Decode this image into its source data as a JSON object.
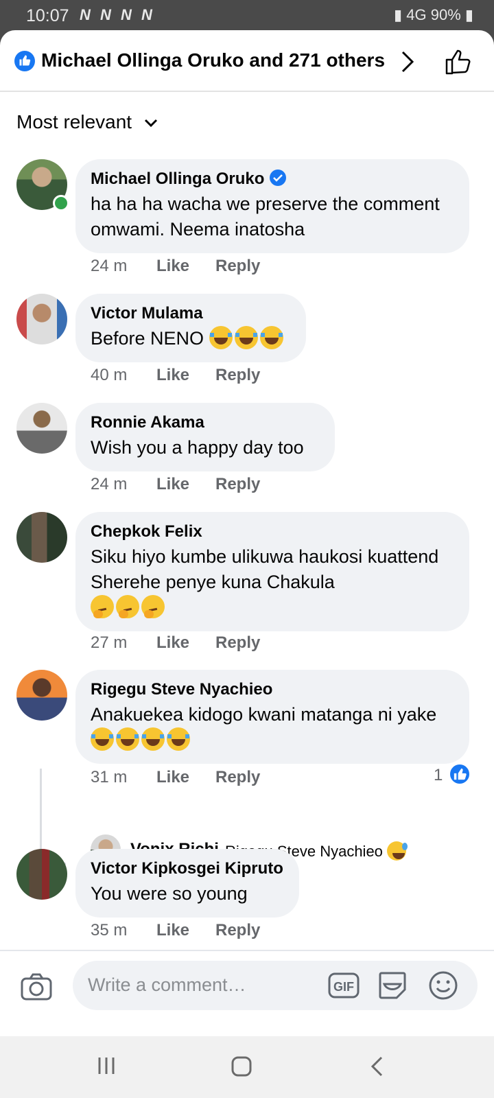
{
  "status": {
    "time": "10:07",
    "notif_icons": "N N N N",
    "signal": "4G",
    "battery": "90%"
  },
  "header": {
    "title": "Michael Ollinga Oruko and 271 others"
  },
  "sort": {
    "label": "Most relevant"
  },
  "comments": [
    {
      "name": "Michael Ollinga Oruko",
      "text": "ha ha ha wacha we preserve the comment omwami. Neema inatosha",
      "time": "24 m",
      "like": "Like",
      "reply": "Reply",
      "verified": true,
      "online": true
    },
    {
      "name": "Victor Mulama",
      "text": "Before NENO",
      "time": "40 m",
      "like": "Like",
      "reply": "Reply"
    },
    {
      "name": "Ronnie Akama",
      "text": "Wish you a happy day too",
      "time": "24 m",
      "like": "Like",
      "reply": "Reply"
    },
    {
      "name": "Chepkok Felix",
      "text": "Siku hiyo kumbe ulikuwa haukosi kuattend Sherehe penye kuna Chakula",
      "time": "27 m",
      "like": "Like",
      "reply": "Reply"
    },
    {
      "name": "Rigegu Steve Nyachieo",
      "text": "Anakuekea kidogo kwani matanga ni yake",
      "time": "31 m",
      "like": "Like",
      "reply": "Reply",
      "reactions": "1"
    },
    {
      "name": "Victor Kipkosgei Kipruto",
      "text": "You were so young",
      "time": "35 m",
      "like": "Like",
      "reply": "Reply"
    }
  ],
  "reply": {
    "name": "Vonix Richi",
    "text": "Rigegu Steve Nyachieo"
  },
  "composer": {
    "placeholder": "Write a comment…",
    "gif": "GIF"
  },
  "colors": {
    "accent": "#1877f2",
    "bubble": "#f0f2f5",
    "meta": "#65676b",
    "online": "#31a24c"
  }
}
